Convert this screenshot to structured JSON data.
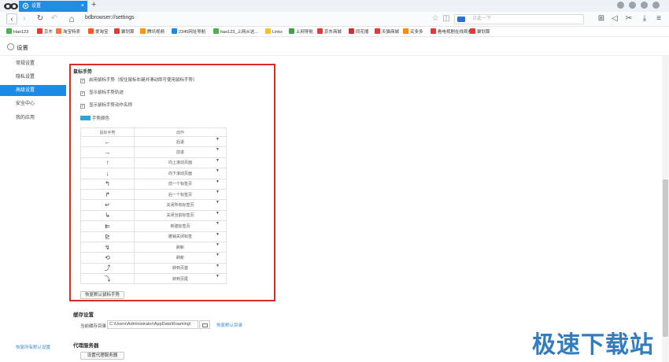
{
  "tab": {
    "title": "设置",
    "close": "×",
    "new_tab": "+"
  },
  "toolbar": {
    "url": "bdbrowser://settings",
    "search_placeholder": "点此一下",
    "back": "‹",
    "forward": "›",
    "refresh": "↻",
    "home": "⌂",
    "star": "☆"
  },
  "bookmarks": [
    {
      "label": "Hao123",
      "color": "#4caf50"
    },
    {
      "label": "京东",
      "color": "#e53935"
    },
    {
      "label": "淘宝特卖",
      "color": "#ff7043"
    },
    {
      "label": "爱淘宝",
      "color": "#ff5722"
    },
    {
      "label": "聚划算",
      "color": "#e53935"
    },
    {
      "label": "腾讯视频",
      "color": "#ff9800"
    },
    {
      "label": "2345网址导航",
      "color": "#1e88e5"
    },
    {
      "label": "hao123_上网从这...",
      "color": "#4caf50"
    },
    {
      "label": "Links",
      "color": "#f5c518"
    },
    {
      "label": "上网导航",
      "color": "#43a047"
    },
    {
      "label": "京东商城",
      "color": "#e53935"
    },
    {
      "label": "同花顺",
      "color": "#d32f2f"
    },
    {
      "label": "天猫商城",
      "color": "#e53935"
    },
    {
      "label": "买多多",
      "color": "#fb8c00"
    },
    {
      "label": "看电视剧在线观看",
      "color": "#e53935"
    },
    {
      "label": "聚划算",
      "color": "#e53935"
    }
  ],
  "page": {
    "title": "设置"
  },
  "sidebar": {
    "items": [
      "常规设置",
      "隐私设置",
      "高级设置",
      "安全中心",
      "我的应用"
    ],
    "active_index": 2,
    "restore_all": "恢复所有默认设置"
  },
  "mouse_gesture": {
    "title": "鼠标手势",
    "options": [
      {
        "label": "启用鼠标手势（按住鼠标右键并滑动即可使用鼠标手势）",
        "checked": true
      },
      {
        "label": "显示鼠标手势轨迹",
        "checked": true
      },
      {
        "label": "显示鼠标手势动作名称",
        "checked": true
      }
    ],
    "color_label": "手势颜色",
    "color": "#2aa6d8",
    "table_headers": [
      "鼠标手势",
      "动作"
    ],
    "rows": [
      {
        "gesture": "←",
        "action": "后退"
      },
      {
        "gesture": "→",
        "action": "前进"
      },
      {
        "gesture": "↑",
        "action": "向上滚动页面"
      },
      {
        "gesture": "↓",
        "action": "向下滚动页面"
      },
      {
        "gesture": "↰",
        "action": "前一个标签页"
      },
      {
        "gesture": "↱",
        "action": "后一个标签页"
      },
      {
        "gesture": "↵",
        "action": "关闭所有标签页"
      },
      {
        "gesture": "↳",
        "action": "关闭当前标签页"
      },
      {
        "gesture": "⇇",
        "action": "新建标签页"
      },
      {
        "gesture": "⊵",
        "action": "撤销关闭标签"
      },
      {
        "gesture": "↯",
        "action": "刷新"
      },
      {
        "gesture": "⟲",
        "action": "刷新"
      },
      {
        "gesture": "⤴",
        "action": "转到页首"
      },
      {
        "gesture": "⤵",
        "action": "转到页尾"
      }
    ],
    "restore_button": "恢复默认鼠标手势"
  },
  "cache": {
    "title": "缓存设置",
    "label": "当前缓存目录",
    "path": "C:\\Users\\Administrator\\AppData\\Roaming\\",
    "restore_link": "恢复默认目录"
  },
  "proxy": {
    "title": "代理服务器",
    "button": "设置代理服务器"
  },
  "watermark": "极速下载站",
  "accent_color": "#1a8ce8",
  "highlight_border": "#e02828"
}
